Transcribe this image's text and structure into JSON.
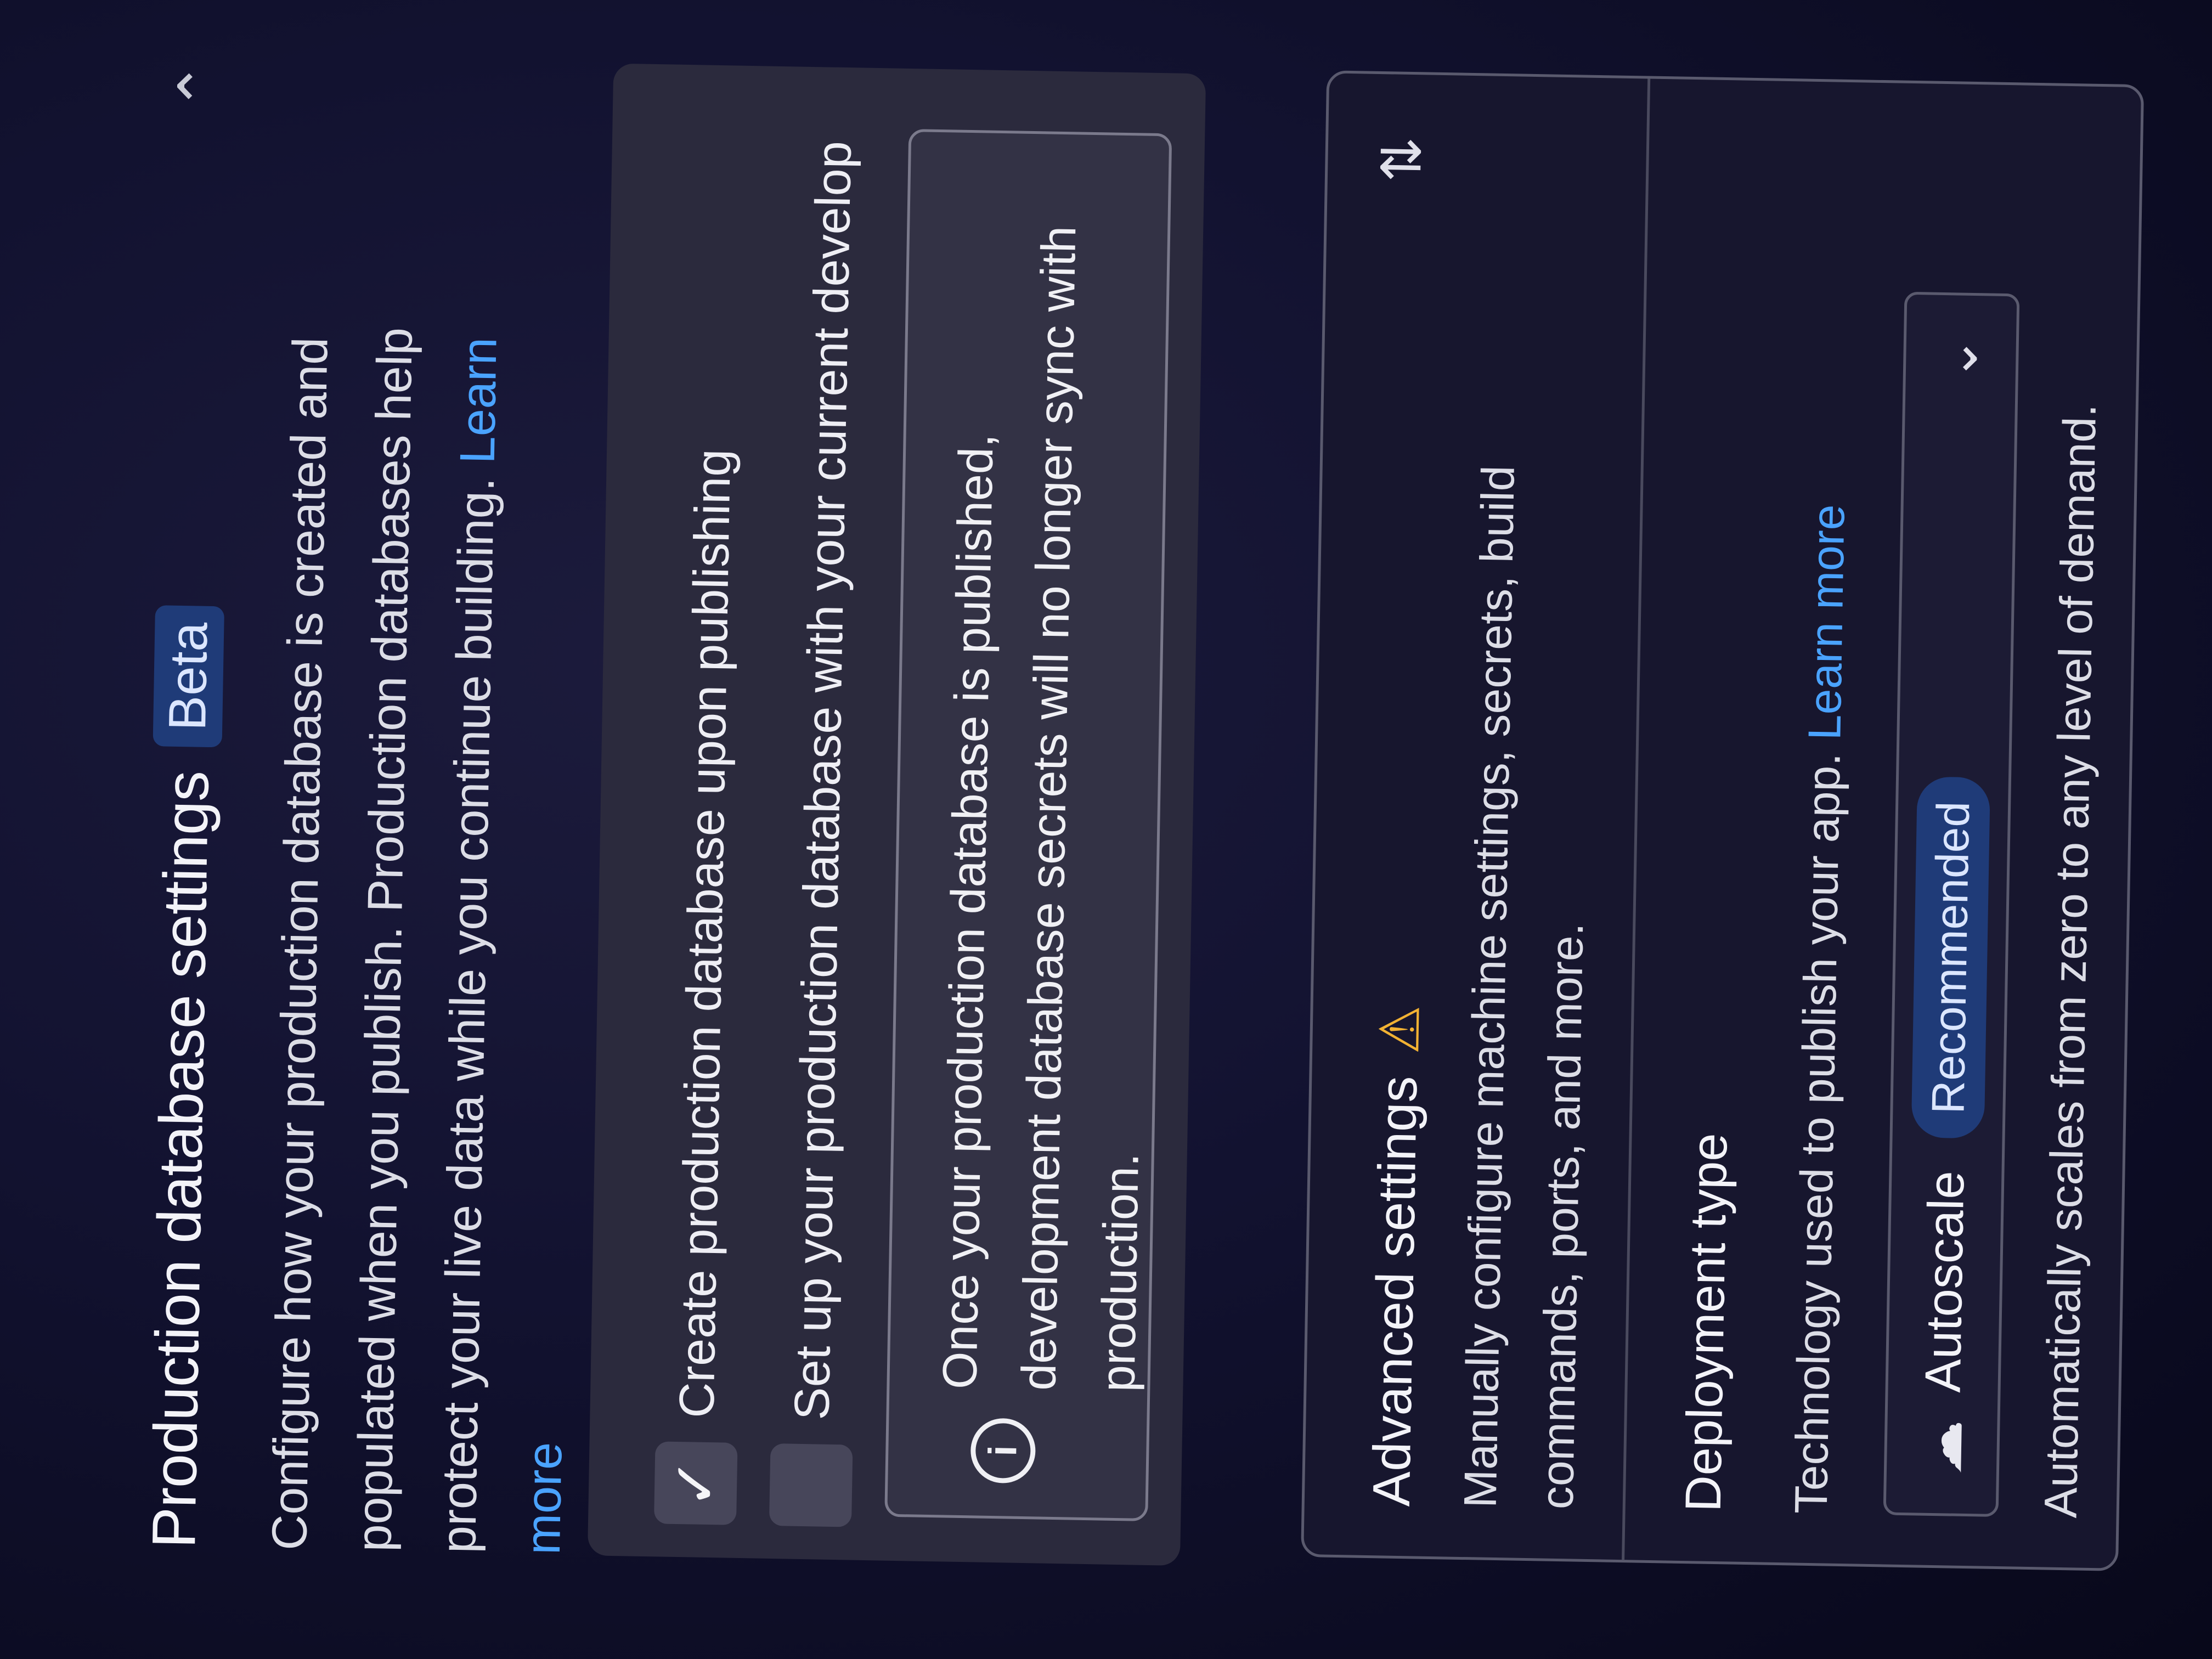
{
  "header": {
    "title": "Production database settings",
    "badge": "Beta",
    "collapse_icon": "chevron-up-icon"
  },
  "intro": {
    "text": "Configure how your production database is created and populated when you publish. Production databases help protect your live data while you continue building.",
    "link": "Learn more"
  },
  "database_options": {
    "create_on_publish": {
      "label": "Create production database upon publishing",
      "checked": true
    },
    "setup_with_dev": {
      "label": "Set up your production database with your current develop",
      "checked": false
    },
    "notice": {
      "icon": "info-icon",
      "text": "Once your production database is published, development database secrets will no longer sync with production."
    }
  },
  "advanced_settings": {
    "title": "Advanced settings",
    "warning_icon": "warning-icon",
    "description": "Manually configure machine settings, secrets, build commands, ports, and more.",
    "toggle_icon": "collapse-icon"
  },
  "deployment_type": {
    "title": "Deployment type",
    "description": "Technology used to publish your app.",
    "link": "Learn more",
    "selected": {
      "icon": "cloud-icon",
      "label": "Autoscale",
      "badge": "Recommended"
    },
    "selected_description": "Automatically scales from zero to any level of demand."
  },
  "colors": {
    "background": "#121230",
    "accent_link": "#4aa3ff",
    "badge_bg": "#1f3b78",
    "warning": "#f2b233"
  }
}
